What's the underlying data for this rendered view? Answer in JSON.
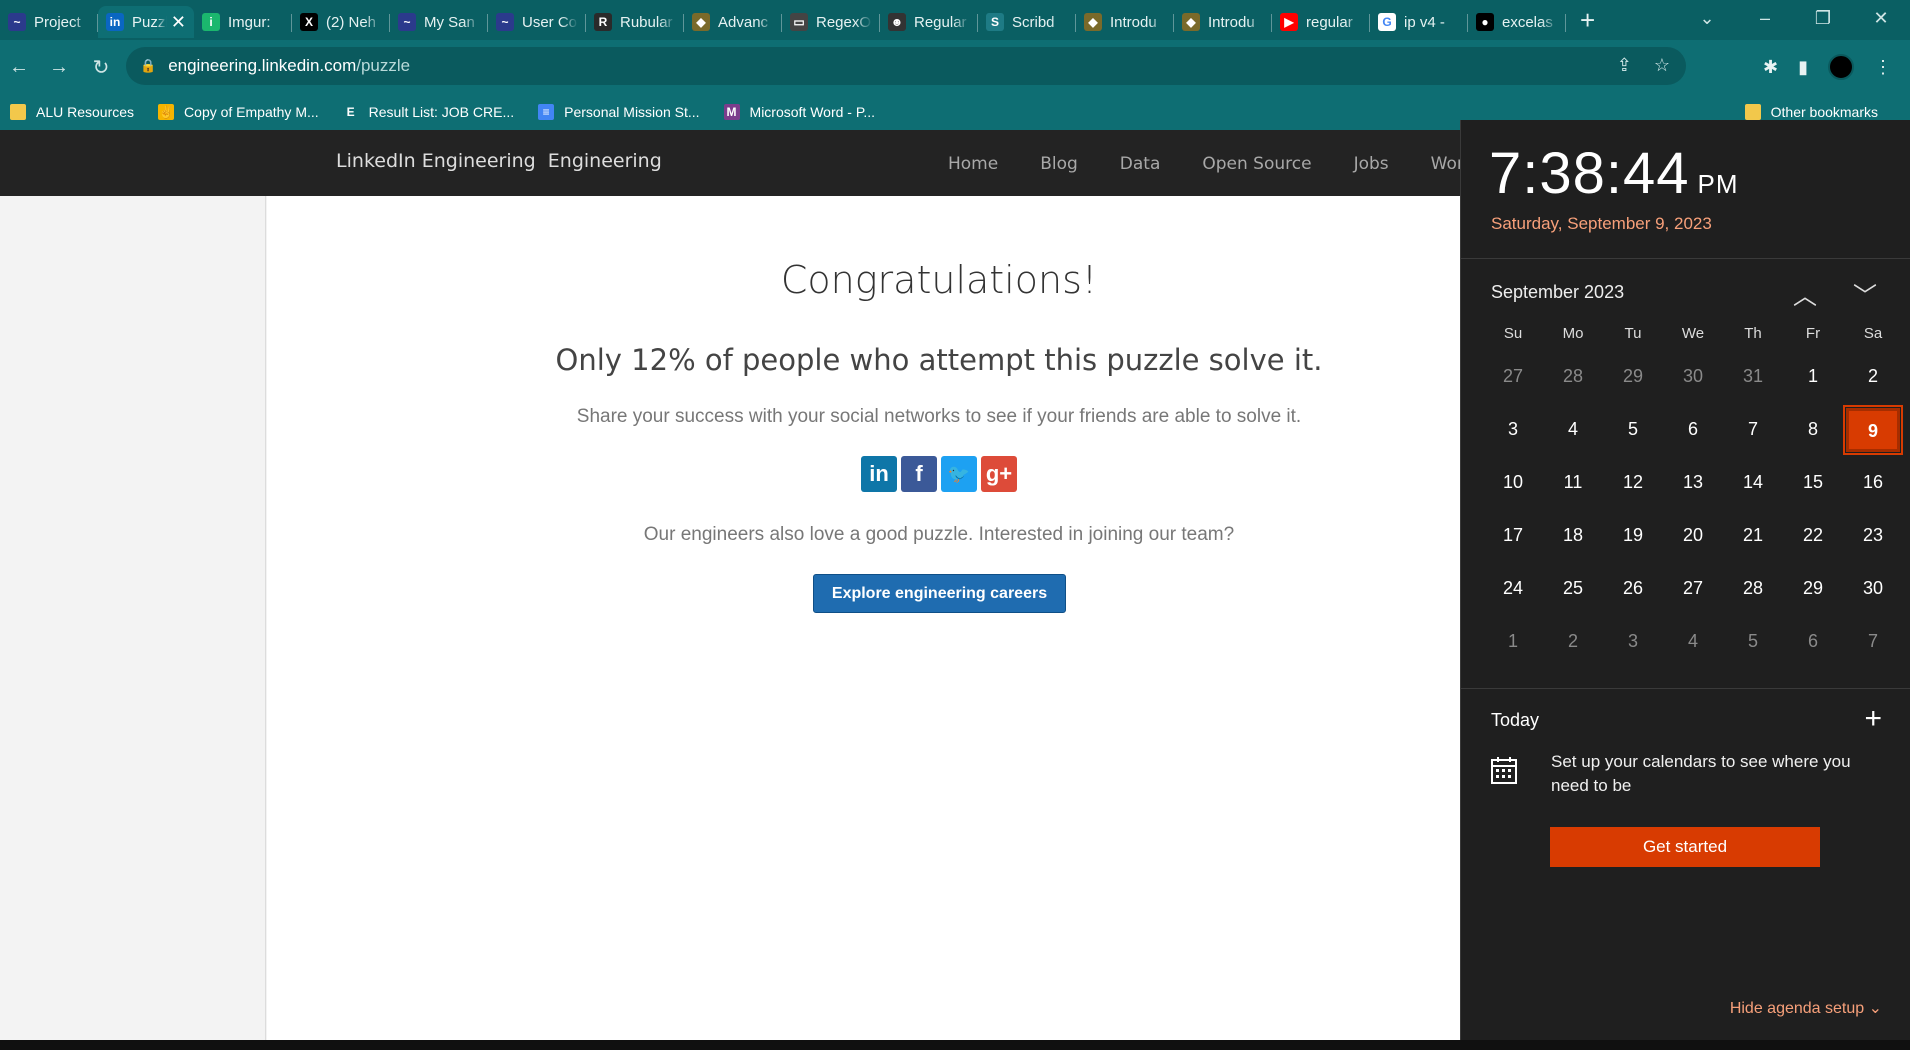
{
  "browser": {
    "tabs": [
      {
        "label": "Project",
        "fav_color": "#2b3a8c",
        "fav_glyph": "~",
        "active": false
      },
      {
        "label": "Puzzle",
        "fav_color": "#0a66c2",
        "fav_glyph": "in",
        "active": true
      },
      {
        "label": "Imgur:",
        "fav_color": "#1bb76e",
        "fav_glyph": "i",
        "active": false
      },
      {
        "label": "(2) Neh",
        "fav_color": "#000000",
        "fav_glyph": "X",
        "active": false
      },
      {
        "label": "My San",
        "fav_color": "#2b3a8c",
        "fav_glyph": "~",
        "active": false
      },
      {
        "label": "User Co",
        "fav_color": "#2b3a8c",
        "fav_glyph": "~",
        "active": false
      },
      {
        "label": "Rubular",
        "fav_color": "#2a2a2a",
        "fav_glyph": "R",
        "active": false
      },
      {
        "label": "Advanc",
        "fav_color": "#7a6a2a",
        "fav_glyph": "◆",
        "active": false
      },
      {
        "label": "RegexO",
        "fav_color": "#444444",
        "fav_glyph": "▭",
        "active": false
      },
      {
        "label": "Regular",
        "fav_color": "#333333",
        "fav_glyph": "☻",
        "active": false
      },
      {
        "label": "Scribd",
        "fav_color": "#1e7b85",
        "fav_glyph": "S",
        "active": false
      },
      {
        "label": "Introdu",
        "fav_color": "#7a6a2a",
        "fav_glyph": "◆",
        "active": false
      },
      {
        "label": "Introdu",
        "fav_color": "#7a6a2a",
        "fav_glyph": "◆",
        "active": false
      },
      {
        "label": "regular",
        "fav_color": "#ff0000",
        "fav_glyph": "▶",
        "active": false
      },
      {
        "label": "ip v4 -",
        "fav_color": "#ffffff",
        "fav_glyph": "G",
        "active": false
      },
      {
        "label": "excelas",
        "fav_color": "#000000",
        "fav_glyph": "●",
        "active": false
      }
    ],
    "url_host": "engineering.linkedin.com",
    "url_path": "/puzzle",
    "bookmarks": [
      {
        "label": "ALU Resources",
        "icon_color": "#f2c84b",
        "glyph": ""
      },
      {
        "label": "Copy of Empathy M...",
        "icon_color": "#f5b400",
        "glyph": "✌"
      },
      {
        "label": "Result List: JOB CRE...",
        "icon_color": "#0e6e73",
        "glyph": "E"
      },
      {
        "label": "Personal Mission St...",
        "icon_color": "#4285f4",
        "glyph": "≡"
      },
      {
        "label": "Microsoft Word - P...",
        "icon_color": "#7b3c8c",
        "glyph": "M"
      }
    ],
    "other_bookmarks": "Other bookmarks"
  },
  "site": {
    "logo_alt": "LinkedIn Engineering",
    "brand": "Engineering",
    "nav": [
      "Home",
      "Blog",
      "Data",
      "Open Source",
      "Jobs",
      "Wor"
    ]
  },
  "main": {
    "heading": "Congratulations!",
    "stat": "Only 12% of people who attempt this puzzle solve it.",
    "share_text": "Share your success with your social networks to see if your friends are able to solve it.",
    "social": [
      {
        "name": "linkedin",
        "glyph": "in",
        "color": "#0e76a8"
      },
      {
        "name": "facebook",
        "glyph": "f",
        "color": "#3b5998"
      },
      {
        "name": "twitter",
        "glyph": "🐦",
        "color": "#1da1f2"
      },
      {
        "name": "googleplus",
        "glyph": "g+",
        "color": "#dd4b39"
      }
    ],
    "join_text": "Our engineers also love a good puzzle. Interested in joining our team?",
    "cta_label": "Explore engineering careers"
  },
  "calendar": {
    "time": "7:38:44",
    "ampm": "PM",
    "long_date": "Saturday, September 9, 2023",
    "month_title": "September 2023",
    "weekdays": [
      "Su",
      "Mo",
      "Tu",
      "We",
      "Th",
      "Fr",
      "Sa"
    ],
    "weeks": [
      [
        {
          "d": "27",
          "dim": true
        },
        {
          "d": "28",
          "dim": true
        },
        {
          "d": "29",
          "dim": true
        },
        {
          "d": "30",
          "dim": true
        },
        {
          "d": "31",
          "dim": true
        },
        {
          "d": "1"
        },
        {
          "d": "2"
        }
      ],
      [
        {
          "d": "3"
        },
        {
          "d": "4"
        },
        {
          "d": "5"
        },
        {
          "d": "6"
        },
        {
          "d": "7"
        },
        {
          "d": "8"
        },
        {
          "d": "9",
          "today": true
        }
      ],
      [
        {
          "d": "10"
        },
        {
          "d": "11"
        },
        {
          "d": "12"
        },
        {
          "d": "13"
        },
        {
          "d": "14"
        },
        {
          "d": "15"
        },
        {
          "d": "16"
        }
      ],
      [
        {
          "d": "17"
        },
        {
          "d": "18"
        },
        {
          "d": "19"
        },
        {
          "d": "20"
        },
        {
          "d": "21"
        },
        {
          "d": "22"
        },
        {
          "d": "23"
        }
      ],
      [
        {
          "d": "24"
        },
        {
          "d": "25"
        },
        {
          "d": "26"
        },
        {
          "d": "27"
        },
        {
          "d": "28"
        },
        {
          "d": "29"
        },
        {
          "d": "30"
        }
      ],
      [
        {
          "d": "1",
          "dim": true
        },
        {
          "d": "2",
          "dim": true
        },
        {
          "d": "3",
          "dim": true
        },
        {
          "d": "4",
          "dim": true
        },
        {
          "d": "5",
          "dim": true
        },
        {
          "d": "6",
          "dim": true
        },
        {
          "d": "7",
          "dim": true
        }
      ]
    ],
    "today_label": "Today",
    "setup_text": "Set up your calendars to see where you need to be",
    "get_started": "Get started",
    "hide_agenda": "Hide agenda setup",
    "accent": "#d83b01"
  }
}
